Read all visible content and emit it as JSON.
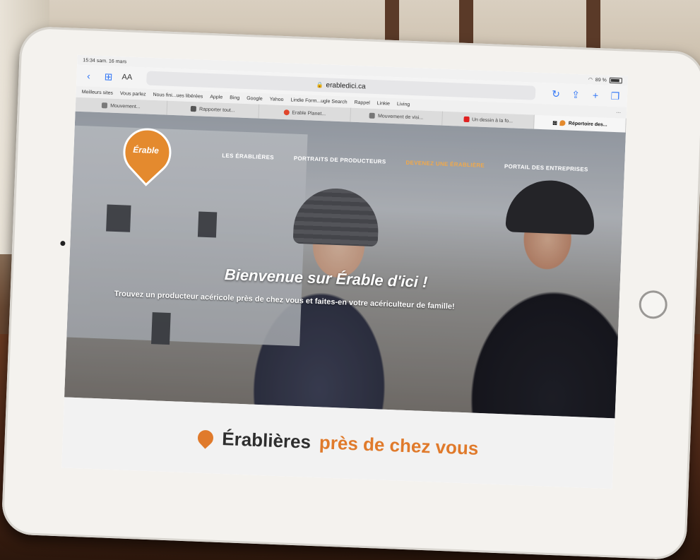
{
  "status_bar": {
    "time": "15:34",
    "date": "sam. 16 mars",
    "battery": "89 %"
  },
  "toolbar": {
    "reader_label": "AA",
    "url": "erabledici.ca"
  },
  "favorites": [
    "Meilleurs sites",
    "Vous parlez",
    "Nous fini...ues libérées",
    "Apple",
    "Bing",
    "Google",
    "Yahoo",
    "Lindie Form...ugle Search",
    "Rappel",
    "Linkie",
    "Living"
  ],
  "tabs": [
    {
      "label": "Mouvement...",
      "color": "#7a7a7a",
      "active": false
    },
    {
      "label": "Rapporter tout...",
      "color": "#555555",
      "active": false
    },
    {
      "label": "Erable Planet...",
      "color": "#e0452b",
      "active": false
    },
    {
      "label": "Mouvement de visi...",
      "color": "#777777",
      "active": false
    },
    {
      "label": "Un dessin à la fo...",
      "color": "#e02020",
      "active": false
    },
    {
      "label": "Répertoire des...",
      "color": "#e48a2e",
      "active": true
    }
  ],
  "site": {
    "logo_text": "Érable",
    "nav": [
      {
        "label": "LES ÉRABLIÈRES",
        "highlight": false
      },
      {
        "label": "PORTRAITS DE PRODUCTEURS",
        "highlight": false
      },
      {
        "label": "DEVENEZ UNE ÉRABLIÈRE",
        "highlight": true
      },
      {
        "label": "PORTAIL DES ENTREPRISES",
        "highlight": false
      }
    ],
    "hero_title": "Bienvenue sur Érable d'ici !",
    "hero_subtitle": "Trouvez un producteur acéricole près de chez vous et faites-en votre acériculteur de famille!",
    "section_title": "Érablières",
    "section_accent": "près de chez vous"
  },
  "colors": {
    "brand_orange": "#e07a2b",
    "nav_highlight": "#f0a94b"
  }
}
